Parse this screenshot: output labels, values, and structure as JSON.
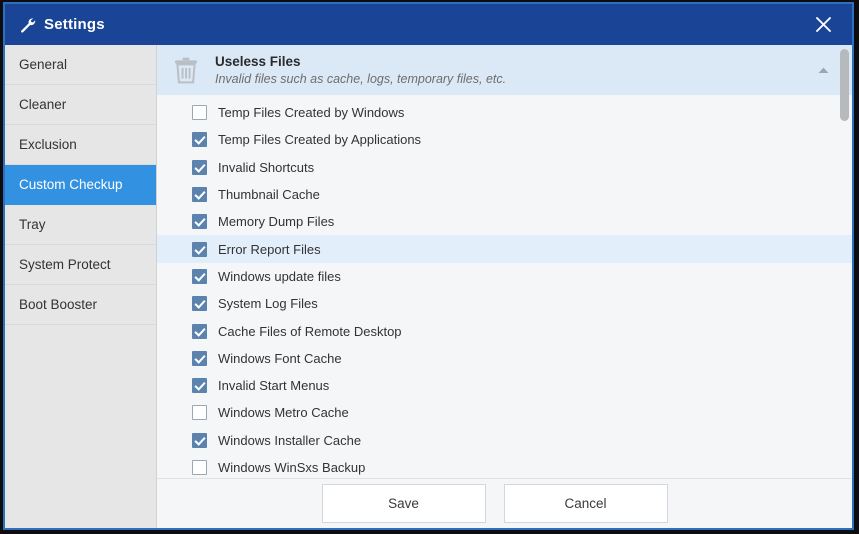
{
  "window": {
    "title": "Settings",
    "title_icon": "wrench-icon",
    "close_icon": "close-icon",
    "accent_titlebar": "#1a4496",
    "accent_selected": "#3391e2",
    "accent_header_band": "#dbe9f7",
    "accent_row_selected": "#e3eefb",
    "checkbox_fill": "#5b83ad"
  },
  "sidebar": {
    "items": [
      {
        "label": "General",
        "active": false
      },
      {
        "label": "Cleaner",
        "active": false
      },
      {
        "label": "Exclusion",
        "active": false
      },
      {
        "label": "Custom Checkup",
        "active": true
      },
      {
        "label": "Tray",
        "active": false
      },
      {
        "label": "System Protect",
        "active": false
      },
      {
        "label": "Boot Booster",
        "active": false
      }
    ]
  },
  "section": {
    "icon": "trash-can-icon",
    "title": "Useless Files",
    "subtitle": "Invalid files such as cache, logs, temporary files, etc.",
    "collapse_icon": "chevron-up-icon"
  },
  "checklist": [
    {
      "label": "Temp Files Created by Windows",
      "checked": false,
      "selected": false
    },
    {
      "label": "Temp Files Created by Applications",
      "checked": true,
      "selected": false
    },
    {
      "label": "Invalid Shortcuts",
      "checked": true,
      "selected": false
    },
    {
      "label": "Thumbnail Cache",
      "checked": true,
      "selected": false
    },
    {
      "label": "Memory Dump Files",
      "checked": true,
      "selected": false
    },
    {
      "label": "Error Report Files",
      "checked": true,
      "selected": true
    },
    {
      "label": "Windows update files",
      "checked": true,
      "selected": false
    },
    {
      "label": "System Log Files",
      "checked": true,
      "selected": false
    },
    {
      "label": "Cache Files of Remote Desktop",
      "checked": true,
      "selected": false
    },
    {
      "label": "Windows Font Cache",
      "checked": true,
      "selected": false
    },
    {
      "label": "Invalid Start Menus",
      "checked": true,
      "selected": false
    },
    {
      "label": "Windows Metro Cache",
      "checked": false,
      "selected": false
    },
    {
      "label": "Windows Installer Cache",
      "checked": true,
      "selected": false
    },
    {
      "label": "Windows WinSxs Backup",
      "checked": false,
      "selected": false
    }
  ],
  "scrollbar": {
    "name": "vertical-scrollbar",
    "thumb_position": "top"
  },
  "footer": {
    "save_label": "Save",
    "cancel_label": "Cancel"
  }
}
